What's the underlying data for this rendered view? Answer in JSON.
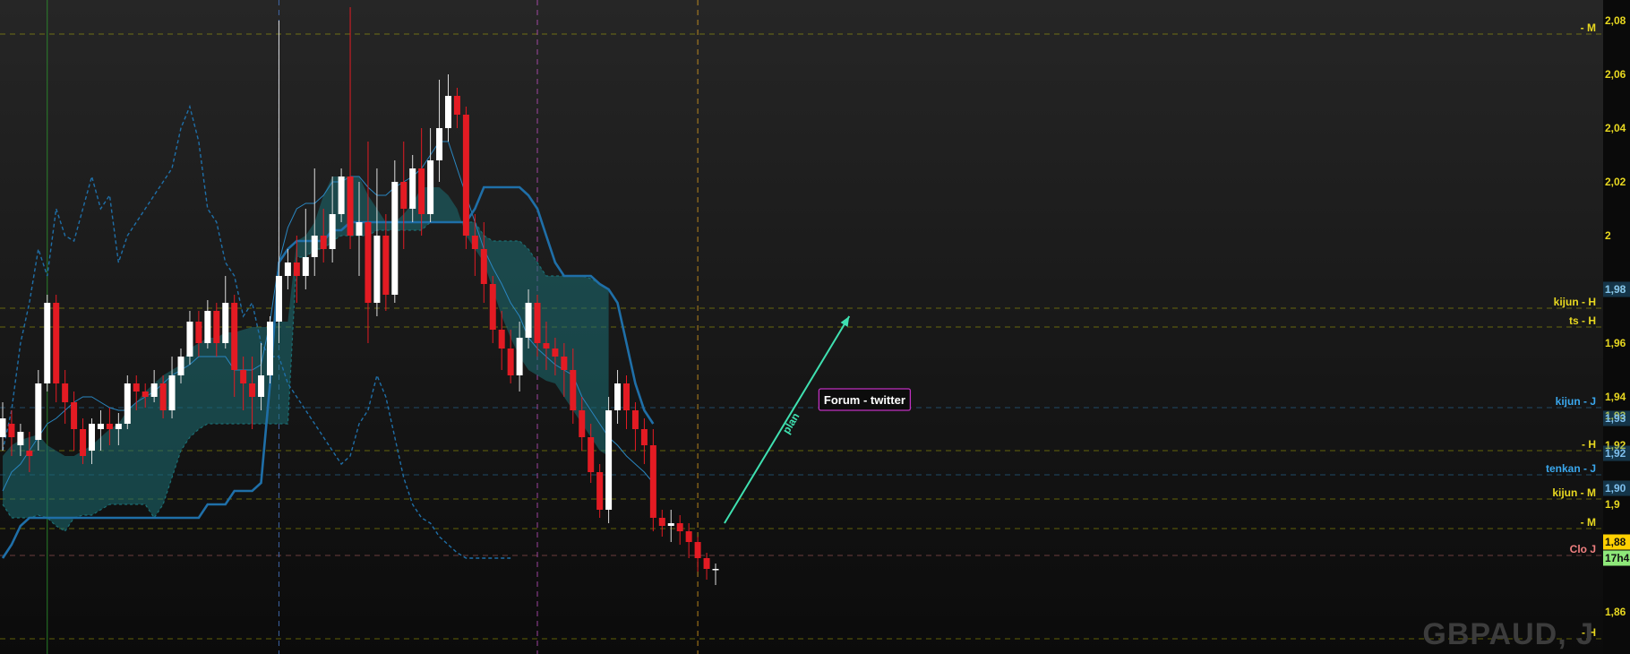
{
  "instrument": "GBPAUD, J",
  "colors": {
    "up_candle": "#ffffff",
    "down_candle": "#e31b23",
    "kijun": "#1f6fa8",
    "tenkan": "#2a86c0",
    "chikou": "#1f6fa8",
    "cloud_fill": "#1b6e73",
    "level_yellow": "#d8d800",
    "level_blue": "#3399dd",
    "level_salmon": "#f08080",
    "plan_arrow": "#3fe0b0",
    "forum_border": "#c030c0"
  },
  "chart_data": {
    "type": "candlestick",
    "ylim": [
      1.845,
      2.085
    ],
    "y_ticks": [
      "2,08",
      "2,06",
      "2,04",
      "2,02",
      "2",
      "1,98",
      "1,96",
      "1,94",
      "1,93",
      "1,92",
      "1,9",
      "1,88",
      "1,86"
    ],
    "tick_values": [
      2.08,
      2.06,
      2.04,
      2.02,
      2.0,
      1.98,
      1.96,
      1.94,
      1.933,
      1.922,
      1.9,
      1.88,
      1.86
    ],
    "price_tags": [
      {
        "label": "1,98",
        "value": 1.98,
        "color": "#2a86c0"
      },
      {
        "label": "1,93",
        "value": 1.932,
        "color": "#2a86c0"
      },
      {
        "label": "1,92",
        "value": 1.919,
        "color": "#2a86c0"
      },
      {
        "label": "1,90",
        "value": 1.906,
        "color": "#2a86c0"
      },
      {
        "label": "1,88",
        "value": 1.886,
        "color": "#ffd000"
      },
      {
        "label": "17h4",
        "value": 1.88,
        "color": "#8ee87a"
      }
    ],
    "candles": [
      [
        1.925,
        1.932,
        1.92,
        1.938
      ],
      [
        1.93,
        1.925,
        1.918,
        1.935
      ],
      [
        1.922,
        1.927,
        1.918,
        1.93
      ],
      [
        1.92,
        1.918,
        1.912,
        1.927
      ],
      [
        1.924,
        1.945,
        1.92,
        1.95
      ],
      [
        1.945,
        1.975,
        1.942,
        1.978
      ],
      [
        1.975,
        1.945,
        1.938,
        1.978
      ],
      [
        1.945,
        1.938,
        1.93,
        1.95
      ],
      [
        1.938,
        1.928,
        1.92,
        1.942
      ],
      [
        1.928,
        1.918,
        1.915,
        1.932
      ],
      [
        1.92,
        1.93,
        1.915,
        1.932
      ],
      [
        1.928,
        1.93,
        1.92,
        1.935
      ],
      [
        1.93,
        1.928,
        1.922,
        1.936
      ],
      [
        1.928,
        1.93,
        1.922,
        1.934
      ],
      [
        1.93,
        1.945,
        1.928,
        1.948
      ],
      [
        1.945,
        1.942,
        1.935,
        1.948
      ],
      [
        1.942,
        1.94,
        1.936,
        1.945
      ],
      [
        1.94,
        1.945,
        1.938,
        1.95
      ],
      [
        1.945,
        1.935,
        1.932,
        1.948
      ],
      [
        1.935,
        1.948,
        1.932,
        1.955
      ],
      [
        1.948,
        1.955,
        1.945,
        1.958
      ],
      [
        1.955,
        1.968,
        1.952,
        1.972
      ],
      [
        1.968,
        1.96,
        1.955,
        1.972
      ],
      [
        1.96,
        1.972,
        1.958,
        1.976
      ],
      [
        1.972,
        1.96,
        1.955,
        1.975
      ],
      [
        1.96,
        1.975,
        1.958,
        1.985
      ],
      [
        1.975,
        1.95,
        1.94,
        1.978
      ],
      [
        1.95,
        1.945,
        1.935,
        1.955
      ],
      [
        1.945,
        1.94,
        1.928,
        1.955
      ],
      [
        1.94,
        1.948,
        1.935,
        1.96
      ],
      [
        1.948,
        1.968,
        1.945,
        1.97
      ],
      [
        1.968,
        1.985,
        1.96,
        2.08
      ],
      [
        1.985,
        1.99,
        1.98,
        1.995
      ],
      [
        1.99,
        1.985,
        1.975,
        2.0
      ],
      [
        1.985,
        1.992,
        1.98,
        2.01
      ],
      [
        1.992,
        2.0,
        1.985,
        2.025
      ],
      [
        2.0,
        1.995,
        1.99,
        2.01
      ],
      [
        1.995,
        2.008,
        1.99,
        2.022
      ],
      [
        2.008,
        2.022,
        2.005,
        2.025
      ],
      [
        2.022,
        2.0,
        1.995,
        2.085
      ],
      [
        2.0,
        2.005,
        1.985,
        2.02
      ],
      [
        2.005,
        1.975,
        1.96,
        2.035
      ],
      [
        1.975,
        2.0,
        1.97,
        2.025
      ],
      [
        2.0,
        1.978,
        1.972,
        2.008
      ],
      [
        1.978,
        2.02,
        1.975,
        2.028
      ],
      [
        2.02,
        2.01,
        1.995,
        2.035
      ],
      [
        2.01,
        2.025,
        2.005,
        2.03
      ],
      [
        2.025,
        2.008,
        2.0,
        2.04
      ],
      [
        2.008,
        2.028,
        2.005,
        2.04
      ],
      [
        2.028,
        2.04,
        2.02,
        2.058
      ],
      [
        2.04,
        2.052,
        2.035,
        2.06
      ],
      [
        2.052,
        2.045,
        2.04,
        2.055
      ],
      [
        2.045,
        2.0,
        1.995,
        2.048
      ],
      [
        2.0,
        1.995,
        1.985,
        2.008
      ],
      [
        1.995,
        1.982,
        1.975,
        2.005
      ],
      [
        1.982,
        1.965,
        1.96,
        1.985
      ],
      [
        1.965,
        1.958,
        1.95,
        1.972
      ],
      [
        1.958,
        1.948,
        1.945,
        1.965
      ],
      [
        1.948,
        1.962,
        1.942,
        1.968
      ],
      [
        1.962,
        1.975,
        1.958,
        1.98
      ],
      [
        1.975,
        1.96,
        1.955,
        1.978
      ],
      [
        1.96,
        1.958,
        1.95,
        1.968
      ],
      [
        1.958,
        1.955,
        1.948,
        1.962
      ],
      [
        1.955,
        1.95,
        1.94,
        1.96
      ],
      [
        1.95,
        1.935,
        1.93,
        1.958
      ],
      [
        1.935,
        1.925,
        1.92,
        1.94
      ],
      [
        1.925,
        1.912,
        1.908,
        1.93
      ],
      [
        1.912,
        1.898,
        1.895,
        1.915
      ],
      [
        1.898,
        1.935,
        1.893,
        1.94
      ],
      [
        1.935,
        1.945,
        1.93,
        1.95
      ],
      [
        1.945,
        1.935,
        1.928,
        1.948
      ],
      [
        1.935,
        1.928,
        1.92,
        1.938
      ],
      [
        1.928,
        1.922,
        1.915,
        1.932
      ],
      [
        1.922,
        1.895,
        1.89,
        1.928
      ],
      [
        1.895,
        1.892,
        1.888,
        1.898
      ],
      [
        1.892,
        1.893,
        1.886,
        1.898
      ],
      [
        1.893,
        1.89,
        1.885,
        1.896
      ],
      [
        1.89,
        1.886,
        1.88,
        1.893
      ],
      [
        1.886,
        1.88,
        1.875,
        1.888
      ],
      [
        1.88,
        1.876,
        1.872,
        1.882
      ],
      [
        1.876,
        1.876,
        1.87,
        1.878
      ]
    ],
    "tenkan": [
      1.905,
      1.912,
      1.915,
      1.92,
      1.925,
      1.93,
      1.932,
      1.935,
      1.938,
      1.94,
      1.94,
      1.938,
      1.936,
      1.935,
      1.935,
      1.938,
      1.94,
      1.942,
      1.945,
      1.948,
      1.95,
      1.952,
      1.955,
      1.955,
      1.955,
      1.955,
      1.95,
      1.95,
      1.95,
      1.952,
      1.968,
      1.99,
      2.003,
      2.01,
      2.012,
      2.012,
      2.015,
      2.02,
      2.02,
      2.022,
      2.022,
      2.018,
      2.015,
      2.015,
      2.018,
      2.02,
      2.022,
      2.025,
      2.03,
      2.035,
      2.035,
      2.025,
      2.015,
      2.005,
      1.995,
      1.988,
      1.982,
      1.975,
      1.97,
      1.962,
      1.958,
      1.955,
      1.952,
      1.95,
      1.948,
      1.94,
      1.935,
      1.93,
      1.925,
      1.922,
      1.918,
      1.915,
      1.912,
      1.908
    ],
    "kijun": [
      1.88,
      1.885,
      1.892,
      1.895,
      1.895,
      1.895,
      1.895,
      1.895,
      1.895,
      1.895,
      1.895,
      1.895,
      1.895,
      1.895,
      1.895,
      1.895,
      1.895,
      1.895,
      1.895,
      1.895,
      1.895,
      1.895,
      1.895,
      1.9,
      1.9,
      1.9,
      1.905,
      1.905,
      1.905,
      1.908,
      1.945,
      1.99,
      1.995,
      1.998,
      1.998,
      1.998,
      1.998,
      2.002,
      2.002,
      2.005,
      2.005,
      2.005,
      2.005,
      2.005,
      2.005,
      2.005,
      2.005,
      2.005,
      2.005,
      2.005,
      2.005,
      2.005,
      2.005,
      2.01,
      2.018,
      2.018,
      2.018,
      2.018,
      2.018,
      2.015,
      2.01,
      2.0,
      1.99,
      1.985,
      1.985,
      1.985,
      1.985,
      1.982,
      1.98,
      1.975,
      1.96,
      1.945,
      1.935,
      1.93
    ],
    "span_a": [
      1.918,
      1.922,
      1.924,
      1.925,
      1.926,
      1.922,
      1.92,
      1.918,
      1.918,
      1.92,
      1.922,
      1.925,
      1.928,
      1.93,
      1.935,
      1.938,
      1.942,
      1.945,
      1.948,
      1.95,
      1.952,
      1.958,
      1.96,
      1.962,
      1.962,
      1.964,
      1.964,
      1.965,
      1.966,
      1.966,
      1.966,
      1.968,
      1.968,
      1.998,
      2.0,
      2.005,
      2.015,
      2.022,
      2.022,
      2.022,
      2.022,
      2.015,
      2.01,
      2.005,
      2.005,
      2.008,
      2.012,
      2.018,
      2.018,
      2.018,
      2.015,
      2.01,
      2.0,
      1.995,
      1.99,
      1.98,
      1.97,
      1.962,
      1.955,
      1.95,
      1.948,
      1.946,
      1.945,
      1.94,
      1.935,
      1.93,
      1.925,
      1.92,
      1.918
    ],
    "span_b": [
      1.9,
      1.895,
      1.895,
      1.895,
      1.896,
      1.895,
      1.892,
      1.89,
      1.895,
      1.896,
      1.896,
      1.898,
      1.9,
      1.9,
      1.9,
      1.9,
      1.9,
      1.895,
      1.9,
      1.91,
      1.92,
      1.925,
      1.928,
      1.93,
      1.93,
      1.93,
      1.93,
      1.93,
      1.93,
      1.93,
      1.93,
      1.93,
      1.93,
      1.992,
      1.992,
      1.995,
      1.995,
      1.998,
      2.0,
      2.0,
      2.0,
      2.0,
      2.002,
      2.002,
      2.002,
      2.002,
      2.002,
      2.002,
      2.005,
      2.005,
      2.005,
      2.005,
      2.005,
      2.005,
      2.0,
      1.998,
      1.998,
      1.998,
      1.998,
      1.995,
      1.99,
      1.985,
      1.985,
      1.985,
      1.985,
      1.985,
      1.984,
      1.982,
      1.98
    ],
    "chikou": [
      1.92,
      1.935,
      1.96,
      1.975,
      1.995,
      1.985,
      2.01,
      2.0,
      1.998,
      2.01,
      2.022,
      2.01,
      2.015,
      1.99,
      2.0,
      2.005,
      2.01,
      2.015,
      2.02,
      2.025,
      2.04,
      2.048,
      2.035,
      2.01,
      2.005,
      1.99,
      1.985,
      1.97,
      1.975,
      1.96,
      1.955,
      1.955,
      1.945,
      1.94,
      1.935,
      1.93,
      1.925,
      1.92,
      1.915,
      1.918,
      1.93,
      1.935,
      1.948,
      1.94,
      1.925,
      1.91,
      1.9,
      1.895,
      1.893,
      1.888,
      1.885,
      1.882,
      1.88,
      1.88,
      1.88,
      1.88,
      1.88,
      1.88
    ],
    "levels": [
      {
        "label": "- M",
        "value": 2.075,
        "color": "#d8d800",
        "style": "dash",
        "text_color": "#e8d820"
      },
      {
        "label": "kijun - H",
        "value": 1.973,
        "color": "#d8d800",
        "style": "dash",
        "text_color": "#e8d820"
      },
      {
        "label": "ts - H",
        "value": 1.966,
        "color": "#d8d800",
        "style": "dash",
        "text_color": "#e8d820"
      },
      {
        "label": "kijun - J",
        "value": 1.936,
        "color": "#3399dd",
        "style": "dash",
        "text_color": "#3aa8ee"
      },
      {
        "label": "- H",
        "value": 1.92,
        "color": "#d8d800",
        "style": "dash",
        "text_color": "#e8d820"
      },
      {
        "label": "tenkan - J",
        "value": 1.911,
        "color": "#3399dd",
        "style": "dash",
        "text_color": "#3aa8ee"
      },
      {
        "label": "kijun - M",
        "value": 1.902,
        "color": "#d8d800",
        "style": "dash",
        "text_color": "#e8d820"
      },
      {
        "label": "- M",
        "value": 1.891,
        "color": "#d8d800",
        "style": "dash",
        "text_color": "#e8d820"
      },
      {
        "label": "Clo J",
        "value": 1.881,
        "color": "#f08080",
        "style": "dash",
        "text_color": "#f08080"
      },
      {
        "label": "- H",
        "value": 1.85,
        "color": "#d8d800",
        "style": "dash",
        "text_color": "#e8d820"
      }
    ],
    "vertical_markers": [
      {
        "index": 5,
        "color": "#2e9a2e",
        "style": "solid"
      },
      {
        "index": 31,
        "color": "#4a78c8",
        "style": "dash"
      },
      {
        "index": 60,
        "color": "#c050c0",
        "style": "dash"
      },
      {
        "index": 78,
        "color": "#e0a020",
        "style": "dash"
      }
    ],
    "annotations": [
      {
        "type": "arrow",
        "label": "plan",
        "from_index": 81,
        "from_value": 1.893,
        "to_index": 95,
        "to_value": 1.97
      },
      {
        "type": "box",
        "label": "Forum - twitter",
        "index": 92,
        "value": 1.939
      }
    ]
  }
}
